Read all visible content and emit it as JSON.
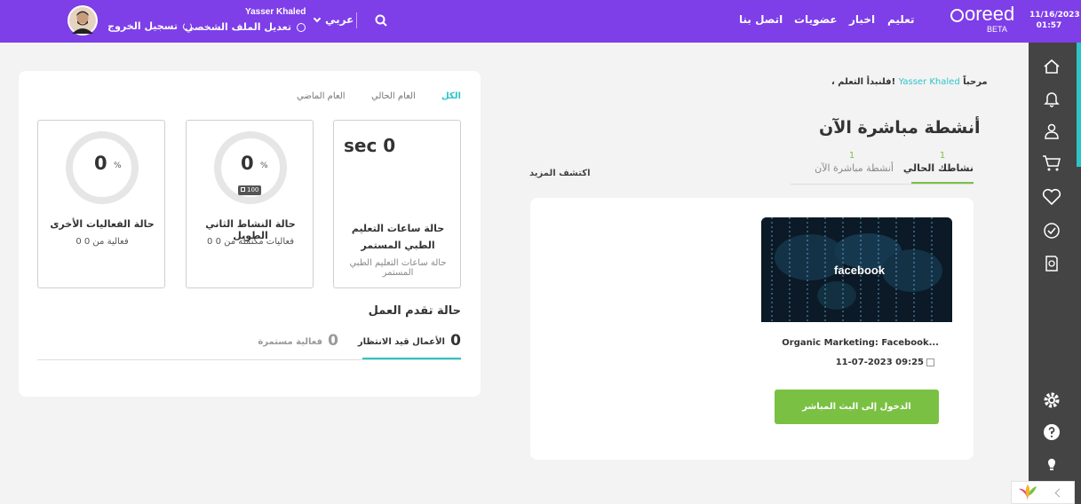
{
  "header": {
    "datetime": {
      "date": "11/16/2023",
      "time": "01:57"
    },
    "logo": {
      "text": "oreed",
      "badge": "BETA"
    },
    "nav": [
      "تعليم",
      "اخبار",
      "عضويات",
      "اتصل بنا"
    ],
    "language": "عربي",
    "user": {
      "name": "Yasser Khaled",
      "edit_profile": "تعديل الملف الشخصي",
      "logout": "تسجيل الخروج"
    }
  },
  "greeting": {
    "prefix": "مرحباً",
    "name": "Yasser Khaled",
    "suffix": "، فلنبدأ التعلم!"
  },
  "live": {
    "title": "أنشطة مباشرة الآن",
    "tabs": [
      {
        "count": "1",
        "label": "نشاطك الحالي"
      },
      {
        "count": "1",
        "label": "أنشطة مباشرة الآن"
      }
    ],
    "discover_more": "اكتشف المزيد",
    "activity": {
      "image_text": "facebook",
      "title": "Organic Marketing: Facebook...",
      "date": "11-07-2023 09:25",
      "enter_button": "الدخول إلى البث المباشر"
    }
  },
  "stats": {
    "filters": [
      "الكل",
      "العام الحالي",
      "العام الماضي"
    ],
    "boxes": [
      {
        "value": "sec 0",
        "title": "حالة ساعات التعليم الطبي المستمر",
        "subtitle": "حالة ساعات التعليم الطبي المستمر"
      },
      {
        "value": "0",
        "unit": "%",
        "badge": "100",
        "title": "حالة النشاط الثاني الطويل",
        "subtitle": "0 فعاليات مكتملة من 0"
      },
      {
        "value": "0",
        "unit": "%",
        "title": "حالة الفعاليات الأخرى",
        "subtitle": "0 فعالية من 0"
      }
    ],
    "progress_title": "حالة تقدم العمل",
    "progress_tabs": [
      {
        "count": "0",
        "label": "الأعمال قيد الانتظار"
      },
      {
        "count": "0",
        "label": "فعالية مستمرة"
      }
    ]
  },
  "colors": {
    "header": "#7e3ee8",
    "sidebar": "#444444",
    "accent": "#2ec4c6",
    "green": "#7ac143"
  },
  "sidebar_icons": [
    "home-icon",
    "bell-icon",
    "user-badge-icon",
    "cart-icon",
    "heart-icon",
    "check-badge-icon",
    "certificate-icon",
    "gear-icon",
    "help-icon",
    "lightbulb-icon"
  ]
}
